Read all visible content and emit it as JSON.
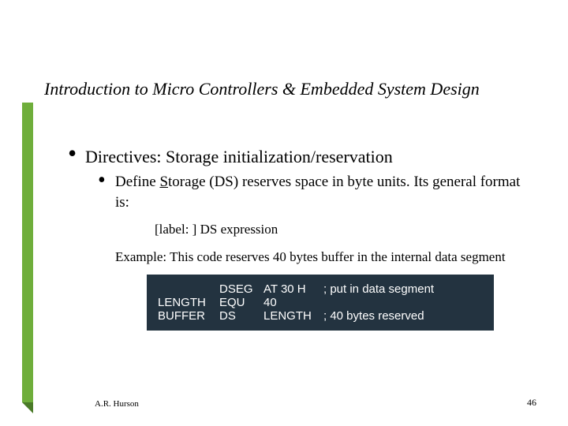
{
  "title": "Introduction to Micro Controllers & Embedded System Design",
  "bullet1": "Directives: Storage initialization/reservation",
  "bullet2_pre": "Define ",
  "bullet2_u": "S",
  "bullet2_post": "torage (DS) reserves space in byte units.  Its general format is:",
  "syntax": "[label: ]   DS   expression",
  "example_intro": "Example:  This code reserves 40 bytes buffer in the internal data segment",
  "code": [
    {
      "label": "",
      "dir": "DSEG",
      "op": "AT   30 H",
      "cmt": "; put in data segment"
    },
    {
      "label": "LENGTH",
      "dir": "EQU",
      "op": "40",
      "cmt": ""
    },
    {
      "label": "BUFFER",
      "dir": "DS",
      "op": "LENGTH",
      "cmt": "; 40 bytes reserved"
    }
  ],
  "footer_author": "A.R. Hurson",
  "footer_page": "46"
}
